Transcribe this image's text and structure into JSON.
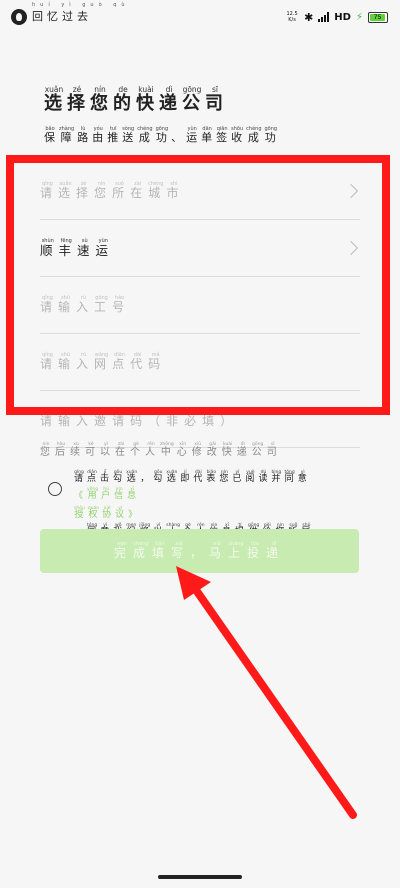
{
  "status_bar": {
    "app_name": "回忆过去",
    "app_name_pinyin": "huí yì guò qù",
    "speed_value": "12.5",
    "speed_unit": "K/s",
    "network": "HD",
    "battery": "75"
  },
  "header": {
    "title": [
      {
        "py": "xuǎn",
        "hz": "选"
      },
      {
        "py": "zé",
        "hz": "择"
      },
      {
        "py": "nín",
        "hz": "您"
      },
      {
        "py": "de",
        "hz": "的"
      },
      {
        "py": "kuài",
        "hz": "快"
      },
      {
        "py": "dì",
        "hz": "递"
      },
      {
        "py": "gōng",
        "hz": "公"
      },
      {
        "py": "sī",
        "hz": "司"
      }
    ],
    "subtitle": [
      {
        "py": "bǎo",
        "hz": "保"
      },
      {
        "py": "zhàng",
        "hz": "障"
      },
      {
        "py": "lù",
        "hz": "路"
      },
      {
        "py": "yóu",
        "hz": "由"
      },
      {
        "py": "tuī",
        "hz": "推"
      },
      {
        "py": "sòng",
        "hz": "送"
      },
      {
        "py": "chéng",
        "hz": "成"
      },
      {
        "py": "gōng",
        "hz": "功"
      },
      {
        "py": "",
        "hz": "、"
      },
      {
        "py": "yùn",
        "hz": "运"
      },
      {
        "py": "dān",
        "hz": "单"
      },
      {
        "py": "qiān",
        "hz": "签"
      },
      {
        "py": "shōu",
        "hz": "收"
      },
      {
        "py": "chéng",
        "hz": "成"
      },
      {
        "py": "gōng",
        "hz": "功"
      }
    ]
  },
  "form": {
    "city": [
      {
        "py": "qǐng",
        "hz": "请"
      },
      {
        "py": "xuǎn",
        "hz": "选"
      },
      {
        "py": "zé",
        "hz": "择"
      },
      {
        "py": "nín",
        "hz": "您"
      },
      {
        "py": "suǒ",
        "hz": "所"
      },
      {
        "py": "zài",
        "hz": "在"
      },
      {
        "py": "chéng",
        "hz": "城"
      },
      {
        "py": "shì",
        "hz": "市"
      }
    ],
    "company": [
      {
        "py": "shùn",
        "hz": "顺"
      },
      {
        "py": "fēng",
        "hz": "丰"
      },
      {
        "py": "sù",
        "hz": "速"
      },
      {
        "py": "yùn",
        "hz": "运"
      }
    ],
    "employee_id": [
      {
        "py": "qǐng",
        "hz": "请"
      },
      {
        "py": "shū",
        "hz": "输"
      },
      {
        "py": "rù",
        "hz": "入"
      },
      {
        "py": "gōng",
        "hz": "工"
      },
      {
        "py": "hào",
        "hz": "号"
      }
    ],
    "outlet_code": [
      {
        "py": "qǐng",
        "hz": "请"
      },
      {
        "py": "shū",
        "hz": "输"
      },
      {
        "py": "rù",
        "hz": "入"
      },
      {
        "py": "wǎng",
        "hz": "网"
      },
      {
        "py": "diǎn",
        "hz": "点"
      },
      {
        "py": "dài",
        "hz": "代"
      },
      {
        "py": "mǎ",
        "hz": "码"
      }
    ],
    "invite_code": [
      {
        "py": "qǐng",
        "hz": "请"
      },
      {
        "py": "shū",
        "hz": "输"
      },
      {
        "py": "rù",
        "hz": "入"
      },
      {
        "py": "yāo",
        "hz": "邀"
      },
      {
        "py": "qǐng",
        "hz": "请"
      },
      {
        "py": "mǎ",
        "hz": "码"
      },
      {
        "py": "",
        "hz": "（"
      },
      {
        "py": "fēi",
        "hz": "非"
      },
      {
        "py": "bì",
        "hz": "必"
      },
      {
        "py": "tián",
        "hz": "填"
      },
      {
        "py": "",
        "hz": "）"
      }
    ]
  },
  "notice": [
    {
      "py": "nín",
      "hz": "您"
    },
    {
      "py": "hòu",
      "hz": "后"
    },
    {
      "py": "xù",
      "hz": "续"
    },
    {
      "py": "kě",
      "hz": "可"
    },
    {
      "py": "yǐ",
      "hz": "以"
    },
    {
      "py": "zài",
      "hz": "在"
    },
    {
      "py": "gè",
      "hz": "个"
    },
    {
      "py": "rén",
      "hz": "人"
    },
    {
      "py": "zhōng",
      "hz": "中"
    },
    {
      "py": "xīn",
      "hz": "心"
    },
    {
      "py": "xiū",
      "hz": "修"
    },
    {
      "py": "gǎi",
      "hz": "改"
    },
    {
      "py": "kuài",
      "hz": "快"
    },
    {
      "py": "dì",
      "hz": "递"
    },
    {
      "py": "gōng",
      "hz": "公"
    },
    {
      "py": "sī",
      "hz": "司"
    }
  ],
  "agreement": {
    "line1": [
      {
        "py": "qǐng",
        "hz": "请"
      },
      {
        "py": "diǎn",
        "hz": "点"
      },
      {
        "py": "jī",
        "hz": "击"
      },
      {
        "py": "gōu",
        "hz": "勾"
      },
      {
        "py": "xuǎn",
        "hz": "选"
      },
      {
        "py": "",
        "hz": "，"
      },
      {
        "py": "gōu",
        "hz": "勾"
      },
      {
        "py": "xuǎn",
        "hz": "选"
      },
      {
        "py": "jí",
        "hz": "即"
      },
      {
        "py": "dài",
        "hz": "代"
      },
      {
        "py": "biǎo",
        "hz": "表"
      },
      {
        "py": "nín",
        "hz": "您"
      },
      {
        "py": "yǐ",
        "hz": "已"
      },
      {
        "py": "yuè",
        "hz": "阅"
      },
      {
        "py": "dú",
        "hz": "读"
      },
      {
        "py": "bìng",
        "hz": "并"
      },
      {
        "py": "tóng",
        "hz": "同"
      },
      {
        "py": "yì",
        "hz": "意"
      }
    ],
    "link1": [
      {
        "py": "",
        "hz": "《"
      },
      {
        "py": "yòng",
        "hz": "用"
      },
      {
        "py": "hù",
        "hz": "户"
      },
      {
        "py": "xìn",
        "hz": "信"
      },
      {
        "py": "xī",
        "hz": "息"
      }
    ],
    "link2": [
      {
        "py": "shòu",
        "hz": "授"
      },
      {
        "py": "quán",
        "hz": "权"
      },
      {
        "py": "xié",
        "hz": "协"
      },
      {
        "py": "yì",
        "hz": "议"
      },
      {
        "py": "",
        "hz": "》"
      }
    ],
    "line2": [
      {
        "py": "",
        "hz": "，"
      },
      {
        "py": "tóng",
        "hz": "同"
      },
      {
        "py": "yì",
        "hz": "意"
      },
      {
        "py": "wǒ",
        "hz": "我"
      },
      {
        "py": "men",
        "hz": "们"
      },
      {
        "py": "jiāng",
        "hz": "将"
      },
      {
        "py": "yǐ",
        "hz": "以"
      },
      {
        "py": "shàng",
        "hz": "上"
      },
      {
        "py": "gè",
        "hz": "个"
      },
      {
        "py": "rén",
        "hz": "人"
      },
      {
        "py": "xìn",
        "hz": "信"
      },
      {
        "py": "xī",
        "hz": "息"
      },
      {
        "py": "tí",
        "hz": "提"
      },
      {
        "py": "gōng",
        "hz": "供"
      },
      {
        "py": "gěi",
        "hz": "给"
      },
      {
        "py": "nín",
        "hz": "您"
      },
      {
        "py": "suǒ",
        "hz": "所"
      },
      {
        "py": "shǔ",
        "hz": "属"
      }
    ],
    "line3": [
      {
        "py": "de",
        "hz": "的"
      },
      {
        "py": "kuài",
        "hz": "快"
      },
      {
        "py": "dì",
        "hz": "递"
      },
      {
        "py": "gōng",
        "hz": "公"
      },
      {
        "py": "sī",
        "hz": "司"
      },
      {
        "py": "jìn",
        "hz": "进"
      },
      {
        "py": "xíng",
        "hz": "行"
      },
      {
        "py": "shēn",
        "hz": "身"
      },
      {
        "py": "fèn",
        "hz": "份"
      },
      {
        "py": "jiào",
        "hz": "校"
      },
      {
        "py": "yàn",
        "hz": "验"
      }
    ]
  },
  "submit": [
    {
      "py": "wán",
      "hz": "完"
    },
    {
      "py": "chéng",
      "hz": "成"
    },
    {
      "py": "tián",
      "hz": "填"
    },
    {
      "py": "xiě",
      "hz": "写"
    },
    {
      "py": "",
      "hz": "，"
    },
    {
      "py": "mǎ",
      "hz": "马"
    },
    {
      "py": "shàng",
      "hz": "上"
    },
    {
      "py": "tóu",
      "hz": "投"
    },
    {
      "py": "dì",
      "hz": "递"
    }
  ],
  "colors": {
    "highlight": "#ff1a1a",
    "arrow": "#ff1a1a",
    "button_bg": "#c8ebb2",
    "link": "#8fd16a"
  }
}
